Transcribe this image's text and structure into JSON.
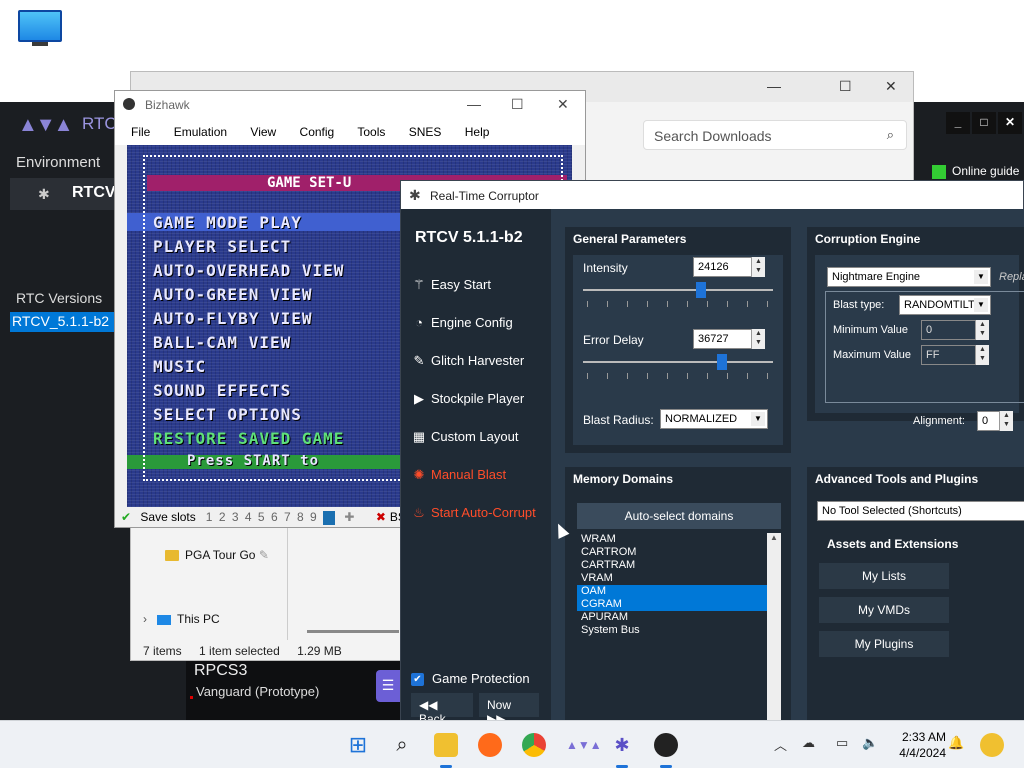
{
  "desktop": {
    "this_pc_label": "This PC"
  },
  "launcher": {
    "logo_text": "RTC",
    "environment_label": "Environment",
    "environment_item": "RTCV",
    "versions_label": "RTC Versions",
    "version_item": "RTCV_5.1.1-b2",
    "online_guide": "Online guide",
    "rpcs3_title": "RPCS3",
    "rpcs3_sub": "Vanguard (Prototype)"
  },
  "explorer": {
    "search_placeholder": "Search Downloads",
    "nav_pga": "PGA Tour Go",
    "nav_pc": "This PC",
    "status_items": "7 items",
    "status_selected": "1 item selected",
    "status_size": "1.29 MB"
  },
  "bizhawk": {
    "title": "Bizhawk",
    "menu": [
      "File",
      "Emulation",
      "View",
      "Config",
      "Tools",
      "SNES",
      "Help"
    ],
    "screen_lines": [
      "GAME SET-U",
      "GAME MODE   PLAY",
      "PLAYER SELECT",
      "AUTO-OVERHEAD VIEW",
      "AUTO-GREEN VIEW",
      "AUTO-FLYBY VIEW",
      "BALL-CAM VIEW",
      "MUSIC",
      "SOUND EFFECTS",
      "SELECT OPTIONS",
      "RESTORE SAVED GAME",
      "Press START to"
    ],
    "save_slots_label": "Save slots",
    "slots": [
      "1",
      "2",
      "3",
      "4",
      "5",
      "6",
      "7",
      "8",
      "9"
    ],
    "core": "BSNES"
  },
  "rtcv": {
    "title": "Real-Time Corruptor",
    "version": "RTCV 5.1.1-b2",
    "nav": [
      "Easy Start",
      "Engine Config",
      "Glitch Harvester",
      "Stockpile Player",
      "Custom Layout",
      "Manual Blast",
      "Start Auto-Corrupt"
    ],
    "game_protection": "Game Protection",
    "back": "Back",
    "now": "Now",
    "general": {
      "header": "General Parameters",
      "intensity_label": "Intensity",
      "intensity_value": "24126",
      "intensity_fraction": 0.62,
      "error_delay_label": "Error Delay",
      "error_delay_value": "36727",
      "error_delay_fraction": 0.73,
      "blast_radius_label": "Blast Radius:",
      "blast_radius_value": "NORMALIZED"
    },
    "engine": {
      "header": "Corruption Engine",
      "engine_value": "Nightmare Engine",
      "replace_label": "Repla",
      "blast_type_label": "Blast type:",
      "blast_type_value": "RANDOMTILT",
      "min_label": "Minimum Value",
      "min_value": "0",
      "max_label": "Maximum Value",
      "max_value": "FF",
      "alignment_label": "Alignment:",
      "alignment_value": "0"
    },
    "memory": {
      "header": "Memory Domains",
      "auto_select": "Auto-select domains",
      "domains": [
        "WRAM",
        "CARTROM",
        "CARTRAM",
        "VRAM",
        "OAM",
        "CGRAM",
        "APURAM",
        "System Bus"
      ],
      "selected": [
        "OAM",
        "CGRAM"
      ]
    },
    "advanced": {
      "header": "Advanced Tools and Plugins",
      "tool_value": "No Tool Selected (Shortcuts)",
      "assets_label": "Assets and Extensions",
      "my_lists": "My Lists",
      "my_vmds": "My VMDs",
      "my_plugins": "My Plugins"
    }
  },
  "taskbar": {
    "time": "2:33 AM",
    "date": "4/4/2024",
    "icons": [
      "windows-start",
      "search",
      "file-explorer",
      "firefox",
      "chrome",
      "rtc-launcher",
      "rtcv",
      "bizhawk"
    ]
  },
  "colors": {
    "accent": "#1e73d8",
    "danger": "#ff4d2a",
    "panel": "#1f2a35",
    "selection": "#0078d7"
  }
}
